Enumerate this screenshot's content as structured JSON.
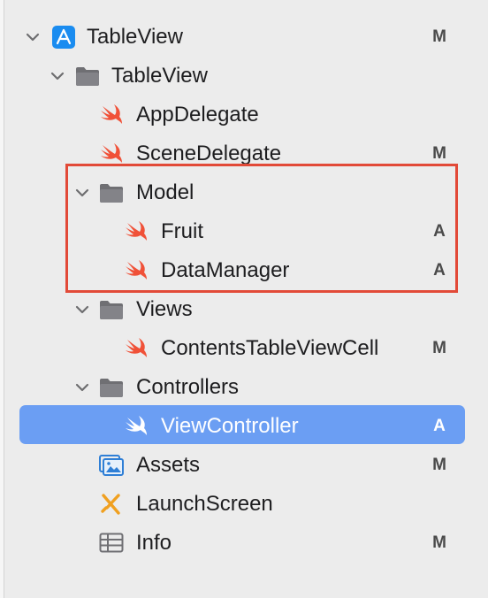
{
  "navigator": {
    "project": {
      "label": "TableView",
      "badge": "M"
    },
    "group_tableview": {
      "label": "TableView"
    },
    "app_delegate": {
      "label": "AppDelegate"
    },
    "scene_delegate": {
      "label": "SceneDelegate",
      "badge": "M"
    },
    "model": {
      "label": "Model"
    },
    "fruit": {
      "label": "Fruit",
      "badge": "A"
    },
    "data_manager": {
      "label": "DataManager",
      "badge": "A"
    },
    "views": {
      "label": "Views"
    },
    "contents_cell": {
      "label": "ContentsTableViewCell",
      "badge": "M"
    },
    "controllers": {
      "label": "Controllers"
    },
    "view_controller": {
      "label": "ViewController",
      "badge": "A"
    },
    "assets": {
      "label": "Assets",
      "badge": "M"
    },
    "launch_screen": {
      "label": "LaunchScreen"
    },
    "info": {
      "label": "Info",
      "badge": "M"
    }
  },
  "colors": {
    "swift_orange": "#f05138",
    "xcode_blue": "#1a8cf0",
    "folder_gray": "#6f6f73",
    "selection": "#6b9ef3",
    "annotation_box": "#e24a38"
  },
  "icons": {
    "project": "xcode-project-icon",
    "folder": "folder-icon",
    "swift": "swift-file-icon",
    "assets": "asset-catalog-icon",
    "storyboard": "storyboard-icon",
    "plist": "plist-icon",
    "disclosure": "chevron-down-icon"
  }
}
